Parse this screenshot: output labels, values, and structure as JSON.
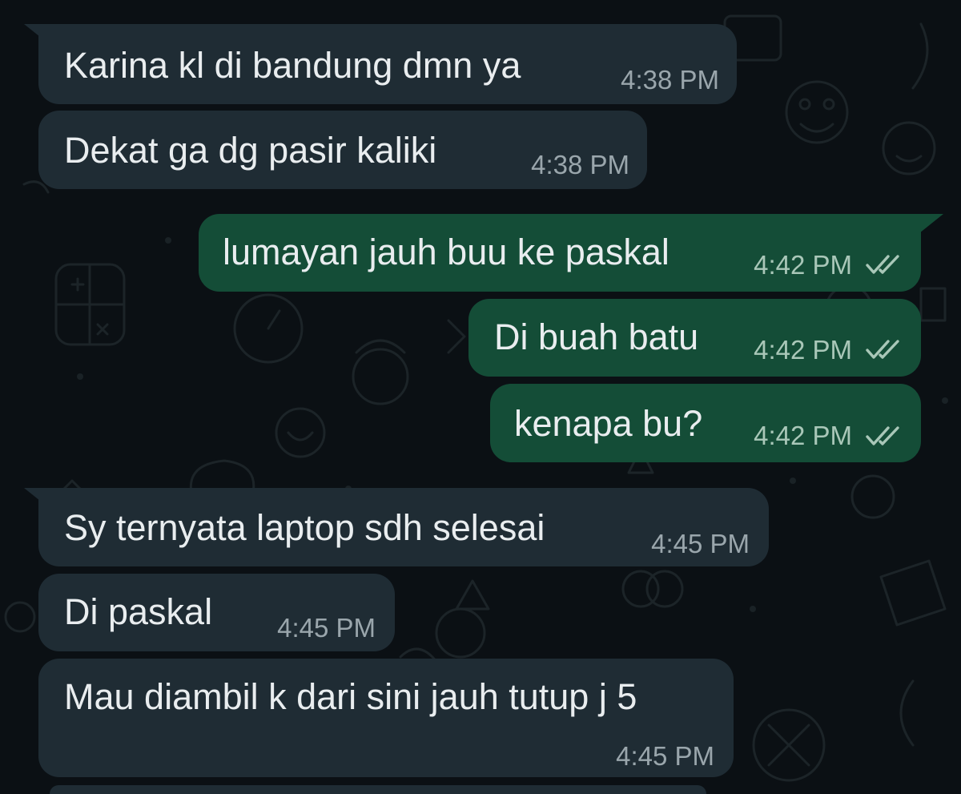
{
  "messages": [
    {
      "direction": "incoming",
      "text": "Karina kl di bandung dmn ya",
      "time": "4:38 PM"
    },
    {
      "direction": "incoming",
      "text": "Dekat ga dg pasir kaliki",
      "time": "4:38 PM"
    },
    {
      "direction": "outgoing",
      "text": "lumayan jauh buu ke paskal",
      "time": "4:42 PM",
      "status": "read"
    },
    {
      "direction": "outgoing",
      "text": "Di buah batu",
      "time": "4:42 PM",
      "status": "read"
    },
    {
      "direction": "outgoing",
      "text": "kenapa bu?",
      "time": "4:42 PM",
      "status": "read"
    },
    {
      "direction": "incoming",
      "text": "Sy ternyata laptop sdh selesai",
      "time": "4:45 PM"
    },
    {
      "direction": "incoming",
      "text": "Di paskal",
      "time": "4:45 PM"
    },
    {
      "direction": "incoming",
      "text": "Mau diambil k dari sini jauh tutup j 5",
      "time": "4:45 PM"
    }
  ],
  "icons": {
    "read_receipt": "double-check-icon"
  },
  "colors": {
    "background": "#0b1014",
    "incoming_bubble": "#1f2c34",
    "outgoing_bubble": "#144d37",
    "text": "#e9edef",
    "timestamp": "#9aa6ac",
    "read_ticks": "#a9c7b8"
  }
}
